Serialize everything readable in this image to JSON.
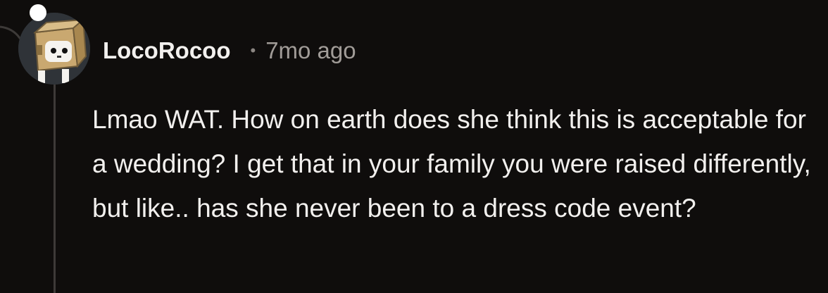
{
  "comment": {
    "author": "LocoRocoo",
    "separator": "•",
    "timestamp": "7mo ago",
    "body": "Lmao WAT. How on earth does she think this is acceptable for a wedding? I get that in your family you were raised differently, but like.. has she never been to a dress code event?"
  },
  "avatar": {
    "icon": "cardboard-robot-avatar-icon"
  },
  "colors": {
    "background": "#0f0d0c",
    "text": "#f2f0ee",
    "muted": "#a19c98",
    "thread_line": "#3d3a38"
  }
}
